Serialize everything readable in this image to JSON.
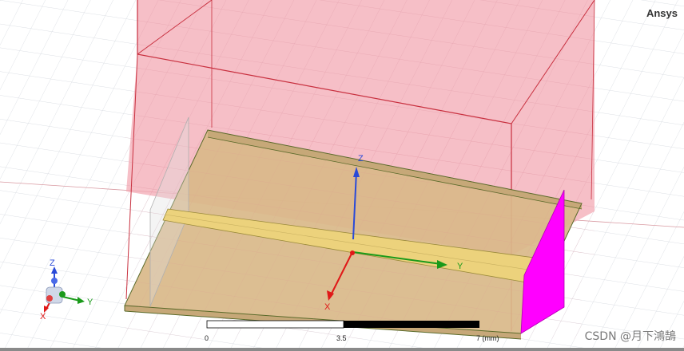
{
  "brand": "Ansys",
  "watermark": "CSDN @月下鴻鵠",
  "scale_bar": {
    "labels": [
      "0",
      "3.5",
      "7 (mm)"
    ]
  },
  "axes": {
    "z": "Z",
    "y": "Y",
    "x": "X"
  },
  "triad": {
    "z": "Z",
    "y": "Y",
    "x": "X"
  },
  "colors": {
    "airbox": "#f3a6b2",
    "airbox_edge": "#c8303f",
    "substrate": "#d9b989",
    "substrate_edge": "#5a6a2a",
    "trace": "#ecd27c",
    "port": "#ff00ff",
    "z_axis": "#2a4ad8",
    "y_axis": "#1a9a1a",
    "x_axis": "#e01818"
  }
}
